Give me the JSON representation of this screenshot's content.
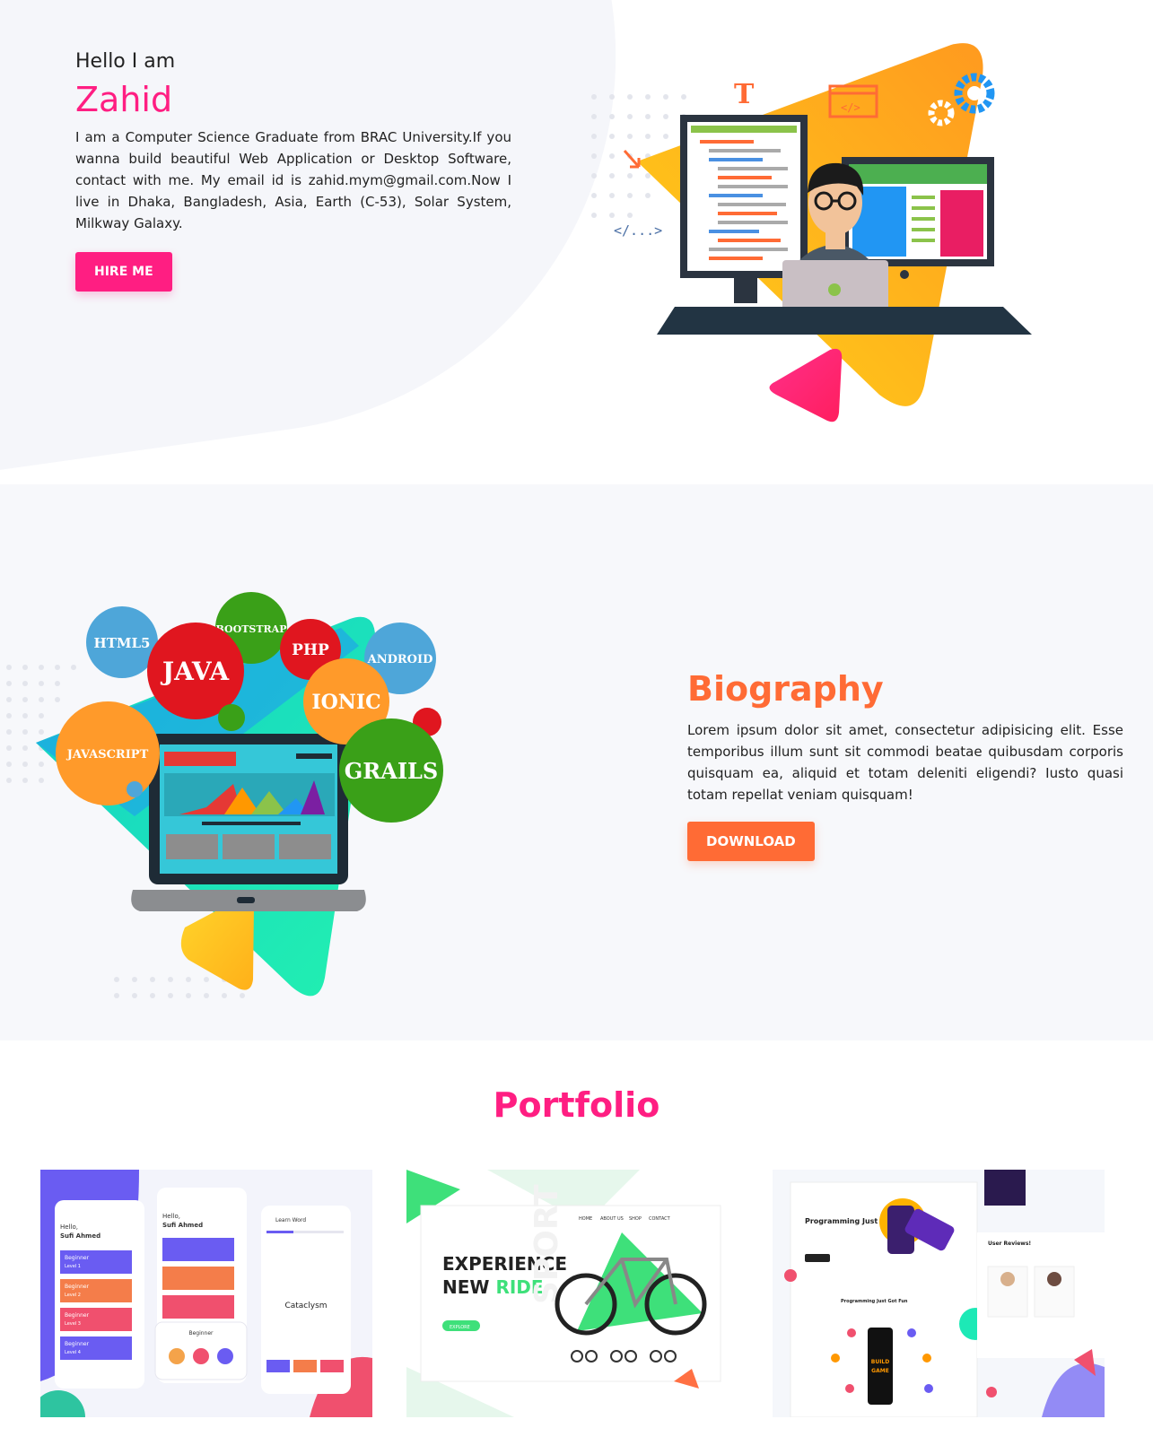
{
  "hero": {
    "greeting": "Hello I am",
    "name": "Zahid",
    "intro": "I am a Computer Science Graduate from BRAC University.If you wanna build beautiful Web Application or Desktop Software, contact with me. My email id is zahid.mym@gmail.com.Now I live in Dhaka, Bangladesh, Asia, Earth (C-53), Solar System, Milkway Galaxy.",
    "hire_label": "HIRE ME",
    "illustration": {
      "code_tag": "</...>",
      "letter": "T"
    }
  },
  "biography": {
    "title": "Biography",
    "text": "Lorem ipsum dolor sit amet, consectetur adipisicing elit. Esse temporibus illum sunt sit commodi beatae quibusdam corporis quisquam ea, aliquid et totam deleniti eligendi? Iusto quasi totam repellat veniam quisquam!",
    "download_label": "DOWNLOAD",
    "skills": [
      "HTML5",
      "JAVA",
      "BOOTSTRAP",
      "PHP",
      "ANDROID",
      "IONIC",
      "JAVASCRIPT",
      "GRAILS"
    ]
  },
  "portfolio": {
    "title": "Portfolio",
    "card1": {
      "greeting": "Hello,",
      "user": "Sufi Ahmed",
      "levels": [
        "Beginner",
        "Beginner",
        "Beginner",
        "Beginner"
      ],
      "sub": [
        "Level 1",
        "Level 2",
        "Level 3",
        "Level 4"
      ],
      "word_title": "Learn Word",
      "word": "Cataclysm",
      "beginner": "Beginner"
    },
    "card2": {
      "headline1": "EXPERIENCE",
      "headline2a": "NEW ",
      "headline2b": "RIDE",
      "side": "SPORT",
      "nav": [
        "HOME",
        "ABOUT US",
        "SHOP",
        "CONTACT"
      ],
      "cta": "EXPLORE"
    },
    "card3": {
      "heading": "Programming Just Got Fun",
      "sub": "Programming Just Got Fun",
      "reviews": "User Reviews!",
      "game_line1": "BUILD",
      "game_line2": "GAME"
    }
  },
  "colors": {
    "pink": "#ff1e82",
    "orange": "#ff6b35",
    "yellow": "#ffc107",
    "teal": "#1de9b6"
  }
}
